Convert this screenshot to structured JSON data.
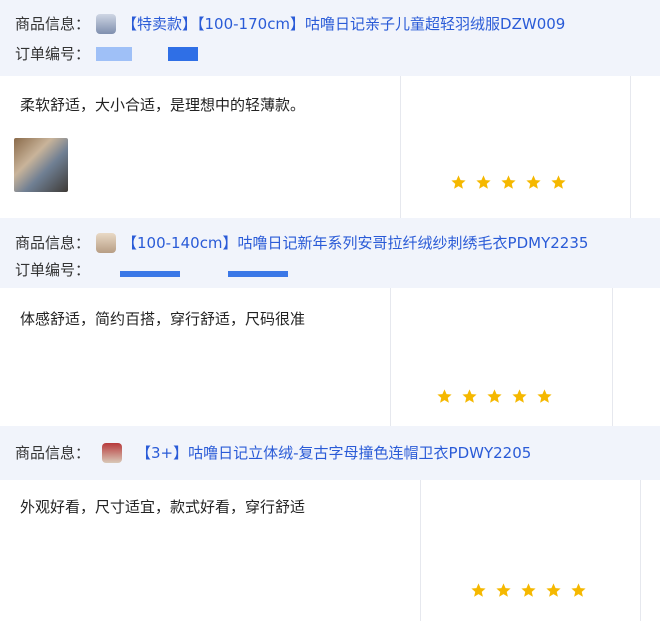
{
  "reviews": [
    {
      "product_label": "商品信息：",
      "product_title": "【特卖款】【100-170cm】咕噜日记亲子儿童超轻羽绒服DZW009",
      "order_label": "订单编号：",
      "thumb_icon": "jacket-thumbnail-icon",
      "review_text": "柔软舒适，大小合适，是理想中的轻薄款。",
      "has_photo": true,
      "rating": 5
    },
    {
      "product_label": "商品信息：",
      "product_title": "【100-140cm】咕噜日记新年系列安哥拉纤绒纱刺绣毛衣PDMY2235",
      "order_label": "订单编号：",
      "thumb_icon": "sweater-thumbnail-icon",
      "review_text": "体感舒适，简约百搭，穿行舒适，尺码很准",
      "has_photo": false,
      "rating": 5
    },
    {
      "product_label": "商品信息：",
      "product_title": "【3+】咕噜日记立体绒-复古字母撞色连帽卫衣PDWY2205",
      "thumb_icon": "hoodie-thumbnail-icon",
      "review_text": "外观好看，尺寸适宜，款式好看，穿行舒适",
      "has_photo": false,
      "rating": 5
    }
  ],
  "colors": {
    "accent": "#2a5bd7",
    "star": "#f5b800",
    "bar_bg": "#f1f4fb"
  }
}
